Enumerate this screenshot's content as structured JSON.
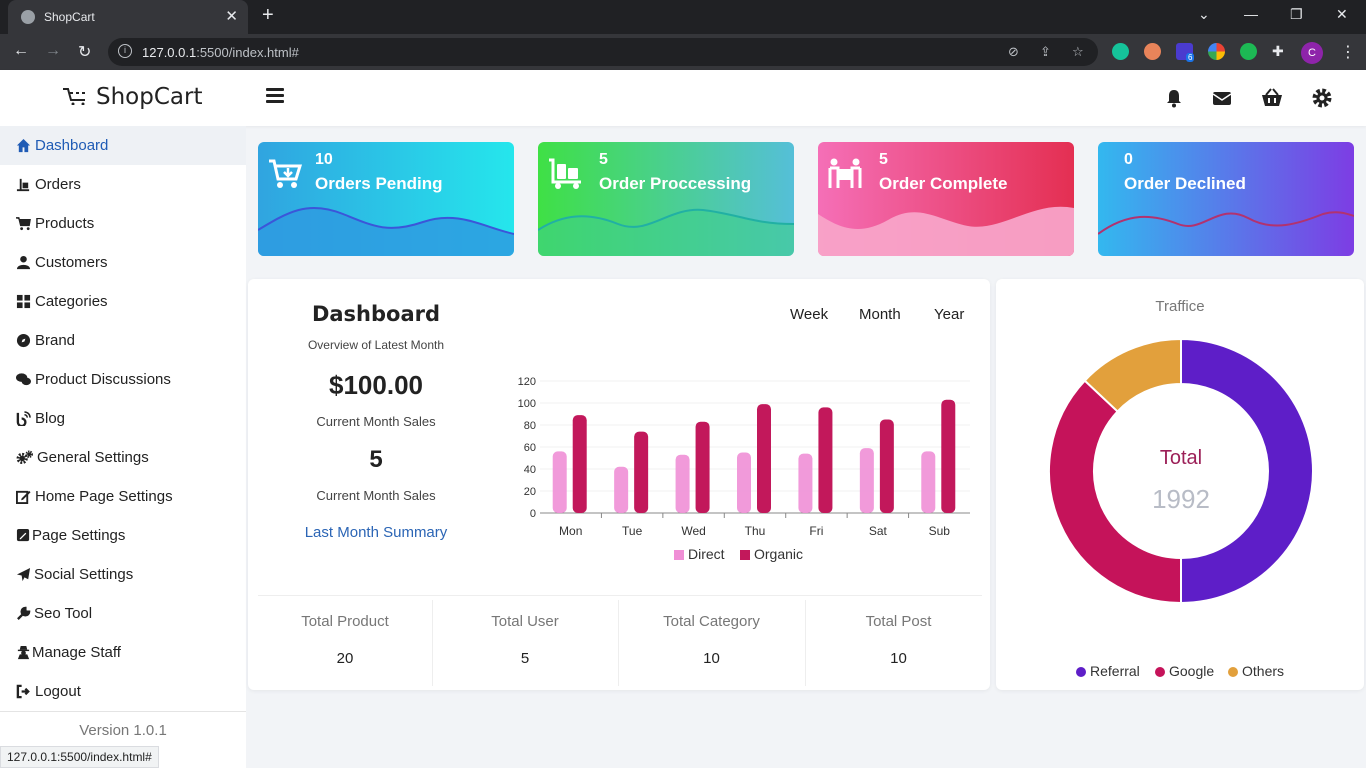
{
  "browser": {
    "tab_title": "ShopCart",
    "url_host": "127.0.0.1",
    "url_rest": ":5500/index.html#",
    "status_url": "127.0.0.1:5500/index.html#",
    "profile_initial": "C",
    "extension_badge": "6"
  },
  "app": {
    "logo_text": "ShopCart"
  },
  "sidebar": {
    "items": [
      {
        "label": "Dashboard",
        "icon": "home-icon",
        "active": true
      },
      {
        "label": "Orders",
        "icon": "dolly-icon"
      },
      {
        "label": "Products",
        "icon": "cart-icon"
      },
      {
        "label": "Customers",
        "icon": "user-icon"
      },
      {
        "label": "Categories",
        "icon": "grid-icon"
      },
      {
        "label": "Brand",
        "icon": "compass-icon"
      },
      {
        "label": "Product Discussions",
        "icon": "comments-icon"
      },
      {
        "label": "Blog",
        "icon": "blog-icon"
      },
      {
        "label": "General Settings",
        "icon": "cogs-icon"
      },
      {
        "label": "Home Page Settings",
        "icon": "edit-icon"
      },
      {
        "label": "Page Settings",
        "icon": "pen-square-icon"
      },
      {
        "label": "Social Settings",
        "icon": "paper-plane-icon"
      },
      {
        "label": "Seo Tool",
        "icon": "wrench-icon"
      },
      {
        "label": "Manage Staff",
        "icon": "user-secret-icon"
      },
      {
        "label": "Logout",
        "icon": "sign-out-icon"
      }
    ],
    "version": "Version 1.0.1"
  },
  "cards": [
    {
      "count": "10",
      "label": "Orders Pending",
      "icon": "cart-plus-icon",
      "colors": [
        "#35a2e3",
        "#27e9ec"
      ]
    },
    {
      "count": "5",
      "label": "Order Proccessing",
      "icon": "luggage-cart-icon",
      "colors": [
        "#3ee046",
        "#54c0d6"
      ]
    },
    {
      "count": "5",
      "label": "Order Complete",
      "icon": "people-carry-icon",
      "colors": [
        "#f77fbf",
        "#e8324b"
      ]
    },
    {
      "count": "0",
      "label": "Order Declined",
      "icon": "",
      "colors": [
        "#35b9ee",
        "#7b3fe4"
      ]
    }
  ],
  "dashboard": {
    "title": "Dashboard",
    "subtitle": "Overview of Latest Month",
    "sales_value": "$100.00",
    "sales_label": "Current Month Sales",
    "count_value": "5",
    "count_label": "Current Month Sales",
    "summary_link": "Last Month Summary",
    "periods": [
      "Week",
      "Month",
      "Year"
    ]
  },
  "chart_data": [
    {
      "type": "bar",
      "categories": [
        "Mon",
        "Tue",
        "Wed",
        "Thu",
        "Fri",
        "Sat",
        "Sub"
      ],
      "series": [
        {
          "name": "Direct",
          "values": [
            56,
            42,
            53,
            55,
            54,
            59,
            56
          ],
          "color": "#f08fd6"
        },
        {
          "name": "Organic",
          "values": [
            89,
            74,
            83,
            99,
            96,
            85,
            103
          ],
          "color": "#c2185b"
        }
      ],
      "ylim": [
        0,
        120
      ],
      "yticks": [
        0,
        20,
        40,
        60,
        80,
        100,
        120
      ],
      "legend": "bottom"
    },
    {
      "type": "pie",
      "title": "Traffice",
      "center_label": "Total",
      "center_value": "1992",
      "labels": [
        "Referral",
        "Google",
        "Others"
      ],
      "values": [
        50,
        37,
        13
      ],
      "colors": [
        "#5e1ec8",
        "#c5135a",
        "#e2a03c"
      ],
      "legend": "bottom"
    }
  ],
  "totals": [
    {
      "label": "Total Product",
      "value": "20"
    },
    {
      "label": "Total User",
      "value": "5"
    },
    {
      "label": "Total Category",
      "value": "10"
    },
    {
      "label": "Total Post",
      "value": "10"
    }
  ]
}
